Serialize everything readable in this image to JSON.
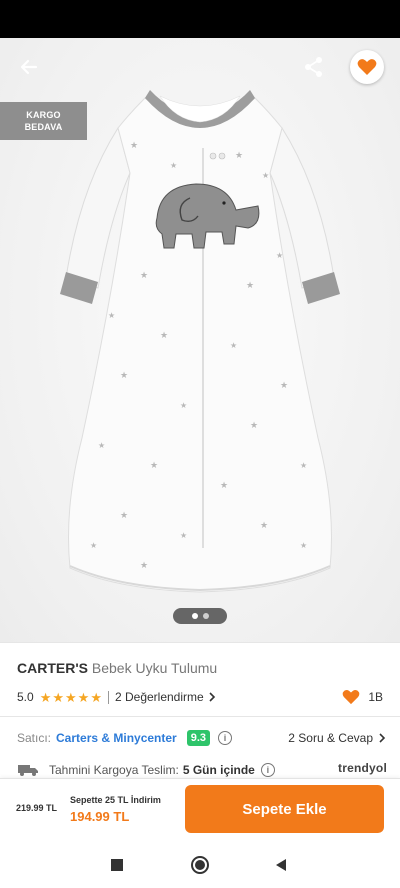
{
  "header": {
    "back_icon": "arrow-left-icon",
    "share_icon": "share-icon",
    "favorite_icon": "heart-icon"
  },
  "hero": {
    "badge_line1": "KARGO",
    "badge_line2": "BEDAVA",
    "image_description_icon": "product-image",
    "pager_count": 2,
    "pager_active": 1
  },
  "product": {
    "brand": "CARTER'S",
    "name": "Bebek Uyku Tulumu",
    "rating": "5.0",
    "stars": 5,
    "reviews": "2 Değerlendirme",
    "likes": "1B"
  },
  "seller": {
    "label": "Satıcı:",
    "name": "Carters & Minycenter",
    "score": "9.3",
    "qa": "2 Soru & Cevap"
  },
  "shipping": {
    "label": "Tahmini Kargoya Teslim:",
    "days": "5 Gün içinde",
    "logo": "trendyol"
  },
  "purchase": {
    "old_price": "219.99 TL",
    "promo": "Sepette 25 TL İndirim",
    "new_price": "194.99 TL",
    "cart_button": "Sepete Ekle"
  },
  "colors": {
    "accent": "#f27a1a",
    "seller_link": "#2d7bd8",
    "score_bg": "#2ec46a",
    "star": "#f5a623"
  }
}
